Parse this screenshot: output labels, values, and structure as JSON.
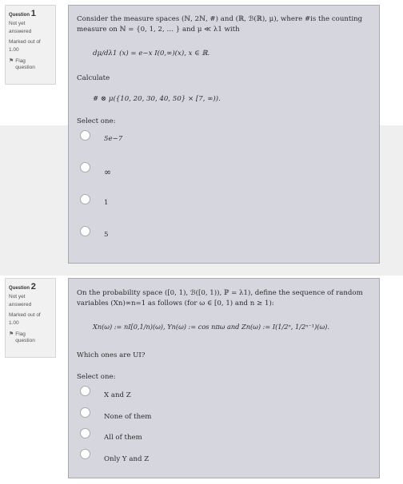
{
  "questions": [
    {
      "number_prefix": "Question",
      "number": "1",
      "status": "Not yet answered",
      "marked": "Marked out of 1.00",
      "flag": "Flag question",
      "prompt_line1": "Consider the measure spaces (ℕ, 2ℕ, #) and (ℝ, ℬ(ℝ), μ), where #is the counting",
      "prompt_line2": "measure on ℕ = {0, 1, 2, … } and μ ≪ λ1 with",
      "formula": "dμ/dλ1 (x) = e−x I(0,∞)(x), x ∈ ℝ.",
      "calc_label": "Calculate",
      "calc_expr": "# ⊗ μ({10, 20, 30, 40, 50} × [7, ∞)).",
      "select_label": "Select one:",
      "options": [
        "5e−7",
        "∞",
        "1",
        "5"
      ]
    },
    {
      "number_prefix": "Question",
      "number": "2",
      "status": "Not yet answered",
      "marked": "Marked out of 1.00",
      "flag": "Flag question",
      "prompt_line1": "On the probability space ([0, 1), ℬ([0, 1)), ℙ = λ1), define the sequence of random",
      "prompt_line2": "variables (Xn)∞n=1 as follows (for ω ∈ [0, 1) and n ≥ 1):",
      "formula": "Xn(ω) := nI[0,1/n)(ω), Yn(ω) := cos nπω and Zn(ω) := I(1/2ⁿ, 1/2ⁿ⁻¹)(ω).",
      "question": "Which ones are UI?",
      "select_label": "Select one:",
      "options": [
        "X and Z",
        "None of them",
        "All of them",
        "Only Y and Z"
      ]
    }
  ]
}
